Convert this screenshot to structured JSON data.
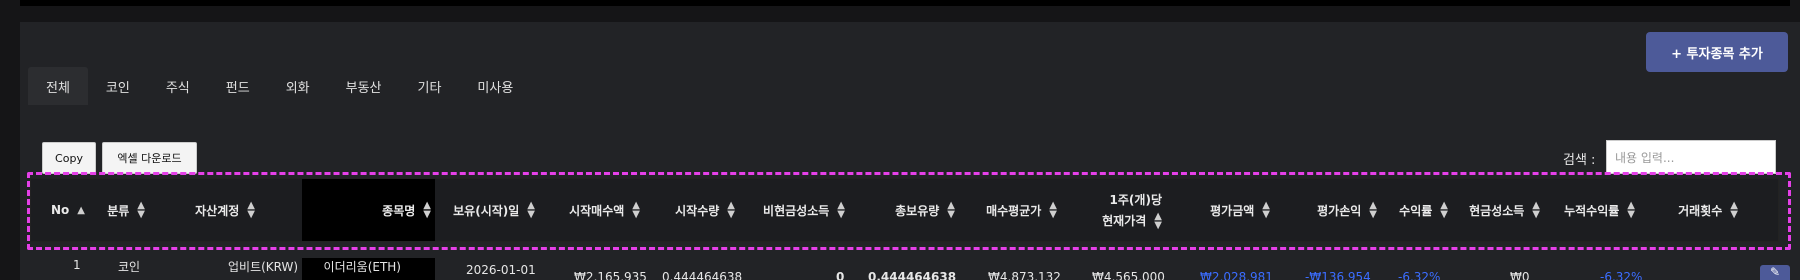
{
  "toolbar": {
    "add_button": "+ 투자종목 추가",
    "copy_button": "Copy",
    "excel_button": "엑셀 다운로드"
  },
  "tabs": [
    "전체",
    "코인",
    "주식",
    "펀드",
    "외화",
    "부동산",
    "기타",
    "미사용"
  ],
  "search": {
    "label": "검색 :",
    "placeholder": "내용 입력..."
  },
  "columns": {
    "no": "No",
    "category": "분류",
    "account": "자산계정",
    "name": "종목명",
    "start_date": "보유(시작)일",
    "start_amount": "시작매수액",
    "start_qty": "시작수량",
    "noncash_income": "비현금성소득",
    "total_qty": "총보유량",
    "avg_price": "매수평균가",
    "unit_price_line1": "1주(개)당",
    "unit_price_line2": "현재가격",
    "eval_amount": "평가금액",
    "eval_pnl": "평가손익",
    "return_rate": "수익률",
    "cash_income": "현금성소득",
    "cum_return": "누적수익률",
    "trade_count": "거래횟수"
  },
  "first_row": {
    "no": "1",
    "category": "코인",
    "account": "업비트(KRW)",
    "name": "이더리움(ETH)",
    "start_date": "2026-01-01",
    "start_amount": "₩2,165,935",
    "start_qty": "0.444464638",
    "noncash_income": "0",
    "total_qty": "0.444464638",
    "avg_price": "₩4,873,132",
    "current_price": "₩4,565,000",
    "eval_amount": "₩2,028,981",
    "eval_pnl": "-₩136,954",
    "return_rate": "-6.32%",
    "cash_income": "₩0",
    "cum_return": "-6.32%"
  },
  "colors": {
    "accent": "#4d5a99",
    "highlight": "#e540e8",
    "negative": "#3b6dff"
  }
}
